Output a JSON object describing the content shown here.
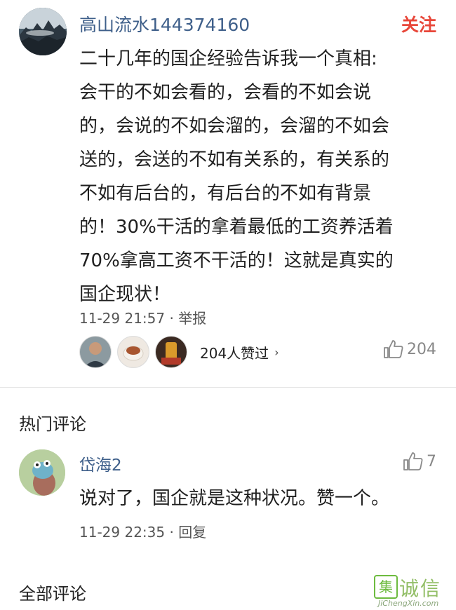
{
  "main_comment": {
    "username": "高山流水144374160",
    "follow_label": "关注",
    "text": "二十几年的国企经验告诉我一个真相:\n会干的不如会看的，会看的不如会说\n的，会说的不如会溜的，会溜的不如会\n送的，会送的不如有关系的，有关系的\n不如有后台的，有后台的不如有背景\n的！30%干活的拿着最低的工资养活着\n70%拿高工资不干活的！这就是真实的\n国企现状！",
    "timestamp": "11-29 21:57",
    "separator": " · ",
    "report_label": "举报",
    "likers_text": "204人赞过",
    "likers_chevron": "›",
    "like_count": "204"
  },
  "hot_section": {
    "title": "热门评论"
  },
  "reply": {
    "username": "岱海2",
    "like_count": "7",
    "text": "说对了，国企就是这种状况。赞一个。",
    "timestamp": "11-29 22:35",
    "separator": " · ",
    "reply_label": "回复"
  },
  "all_section": {
    "title": "全部评论"
  },
  "watermark": {
    "logo_char": "集",
    "text_cn": "诚信",
    "text_en": "JiChengXin.com"
  },
  "colors": {
    "username": "#3e5f8a",
    "follow": "#e8473a",
    "watermark": "#6dbb3f"
  }
}
